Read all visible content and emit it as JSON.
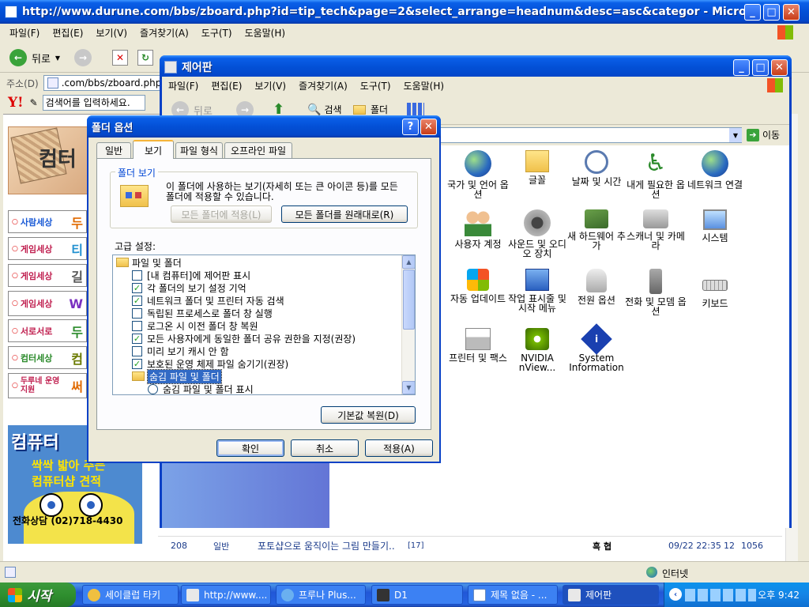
{
  "ie": {
    "title": "http://www.durune.com/bbs/zboard.php?id=tip_tech&page=2&select_arrange=headnum&desc=asc&categor - Microsoft Inter...",
    "menu": [
      "파일(F)",
      "편집(E)",
      "보기(V)",
      "즐겨찾기(A)",
      "도구(T)",
      "도움말(H)"
    ],
    "back_label": "뒤로",
    "address_label": "주소(D)",
    "address_value": ".com/bbs/zboard.php",
    "yahoo_placeholder": "검색어를 입력하세요.",
    "banner_text": "컴터",
    "side_items": [
      {
        "prefix": "사람세상",
        "tail": "두"
      },
      {
        "prefix": "게임세상",
        "tail": "티"
      },
      {
        "prefix": "게임세상",
        "tail": "길"
      },
      {
        "prefix": "게임세상",
        "tail": "W"
      },
      {
        "prefix": "서로서로",
        "tail": "두"
      },
      {
        "prefix": "컴터세상",
        "tail": "컴"
      },
      {
        "prefix": "두루네 운영지원",
        "tail": "써"
      }
    ],
    "ad": {
      "title": "컴퓨터",
      "line1": "싹싹 밟아 주는",
      "line2": "컴퓨터샵 견적",
      "phone": "전화상담 (02)718-4430"
    },
    "bottom_row": {
      "num": "208",
      "category": "일반",
      "subject": "포토샵으로 움직이는 그림 만들기..",
      "comments": "[17]",
      "author": "흑 협",
      "date": "09/22 22:35",
      "votes": "12",
      "hits": "1056"
    },
    "status_zone": "인터넷"
  },
  "cp": {
    "title": "제어판",
    "menu": [
      "파일(F)",
      "편집(E)",
      "보기(V)",
      "즐겨찾기(A)",
      "도구(T)",
      "도움말(H)"
    ],
    "back_label": "뒤로",
    "search_label": "검색",
    "folder_label": "폴더",
    "go_label": "이동",
    "items": [
      {
        "label": "국가 및 언어 옵션",
        "icon": "globe-icon"
      },
      {
        "label": "글꼴",
        "icon": "fonts-folder-icon"
      },
      {
        "label": "날짜 및 시간",
        "icon": "clock-icon"
      },
      {
        "label": "내게 필요한 옵션",
        "icon": "accessibility-icon"
      },
      {
        "label": "네트워크 연결",
        "icon": "network-icon"
      },
      {
        "label": "사용자 계정",
        "icon": "users-icon"
      },
      {
        "label": "사운드 및 오디오 장치",
        "icon": "speaker-icon"
      },
      {
        "label": "새 하드웨어 추가",
        "icon": "hardware-icon"
      },
      {
        "label": "스캐너 및 카메라",
        "icon": "camera-icon"
      },
      {
        "label": "시스템",
        "icon": "system-icon"
      },
      {
        "label": "자동 업데이트",
        "icon": "windows-update-icon"
      },
      {
        "label": "작업 표시줄 및 시작 메뉴",
        "icon": "taskbar-icon"
      },
      {
        "label": "전원 옵션",
        "icon": "power-icon"
      },
      {
        "label": "전화 및 모뎀 옵션",
        "icon": "phone-icon"
      },
      {
        "label": "키보드",
        "icon": "keyboard-icon"
      },
      {
        "label": "프린터 및 팩스",
        "icon": "printer-icon"
      },
      {
        "label": "NVIDIA nView...",
        "icon": "nvidia-icon"
      },
      {
        "label": "System Information",
        "icon": "info-icon"
      }
    ]
  },
  "dialog": {
    "title": "폴더 옵션",
    "tabs": [
      "일반",
      "보기",
      "파일 형식",
      "오프라인 파일"
    ],
    "active_tab": "보기",
    "folder_view_group": "폴더 보기",
    "folder_view_desc": "이 폴더에 사용하는 보기(자세히 또는 큰 아이콘 등)를 모든 폴더에 적용할 수 있습니다.",
    "apply_all_button": "모든 폴더에 적용(L)",
    "reset_all_button": "모든 폴더를 원래대로(R)",
    "advanced_label": "고급 설정:",
    "tree": [
      {
        "type": "folder",
        "label": "파일 및 폴더"
      },
      {
        "type": "check",
        "checked": false,
        "label": "[내 컴퓨터]에 제어판 표시"
      },
      {
        "type": "check",
        "checked": true,
        "label": "각 폴더의 보기 설정 기억"
      },
      {
        "type": "check",
        "checked": true,
        "label": "네트워크 폴더 및 프린터 자동 검색"
      },
      {
        "type": "check",
        "checked": false,
        "label": "독립된 프로세스로 폴더 창 실행"
      },
      {
        "type": "check",
        "checked": false,
        "label": "로그온 시 이전 폴더 창 복원"
      },
      {
        "type": "check",
        "checked": true,
        "label": "모든 사용자에게 동일한 폴더 공유 권한을 지정(권장)"
      },
      {
        "type": "check",
        "checked": false,
        "label": "미리 보기 캐시 안 함"
      },
      {
        "type": "check",
        "checked": true,
        "label": "보호된 운영 체제 파일 숨기기(권장)"
      },
      {
        "type": "folder-selected",
        "label": "숨김 파일 및 폴더"
      },
      {
        "type": "radio",
        "label": "숨김 파일 및 폴더 표시"
      }
    ],
    "restore_defaults_button": "기본값 복원(D)",
    "ok_button": "확인",
    "cancel_button": "취소",
    "apply_button": "적용(A)"
  },
  "taskbar": {
    "start_label": "시작",
    "tasks": [
      "세이클럽 타키",
      "http://www....",
      "프루나 Plus...",
      "D1",
      "제목 없음 - ...",
      "제어판"
    ],
    "active_task": "제어판",
    "clock": "오후 9:42"
  },
  "colors": {
    "xp_blue": "#0350d6",
    "dialog_bg": "#ece9d8",
    "selection": "#316ac5"
  }
}
